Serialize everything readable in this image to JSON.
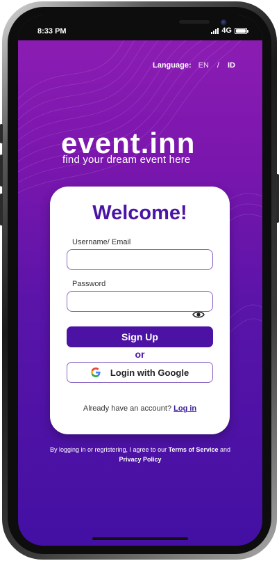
{
  "status_bar": {
    "time": "8:33 PM",
    "network": "4G",
    "signal_icon": "signal-bars-icon",
    "battery_icon": "battery-icon"
  },
  "language": {
    "label": "Language:",
    "options": [
      "EN",
      "ID"
    ],
    "separator": "/",
    "selected": "ID"
  },
  "brand": {
    "logo": "event.inn",
    "tagline": "find your dream event here"
  },
  "login_card": {
    "title": "Welcome!",
    "username_label": "Username/ Email",
    "username_value": "",
    "password_label": "Password",
    "password_value": "",
    "signup_button": "Sign Up",
    "or_text": "or",
    "google_button": "Login with Google",
    "account_prompt": "Already have an account?",
    "login_link": "Log in"
  },
  "terms": {
    "prefix": "By logging in or regristering, I agree to our",
    "terms_link": "Terms of Service",
    "and": "and",
    "privacy_link": "Privacy Policy"
  },
  "colors": {
    "primary": "#4b12a4",
    "gradient_top": "#8f1eb4",
    "gradient_bottom": "#4310a3",
    "input_border": "#8a66c4"
  }
}
